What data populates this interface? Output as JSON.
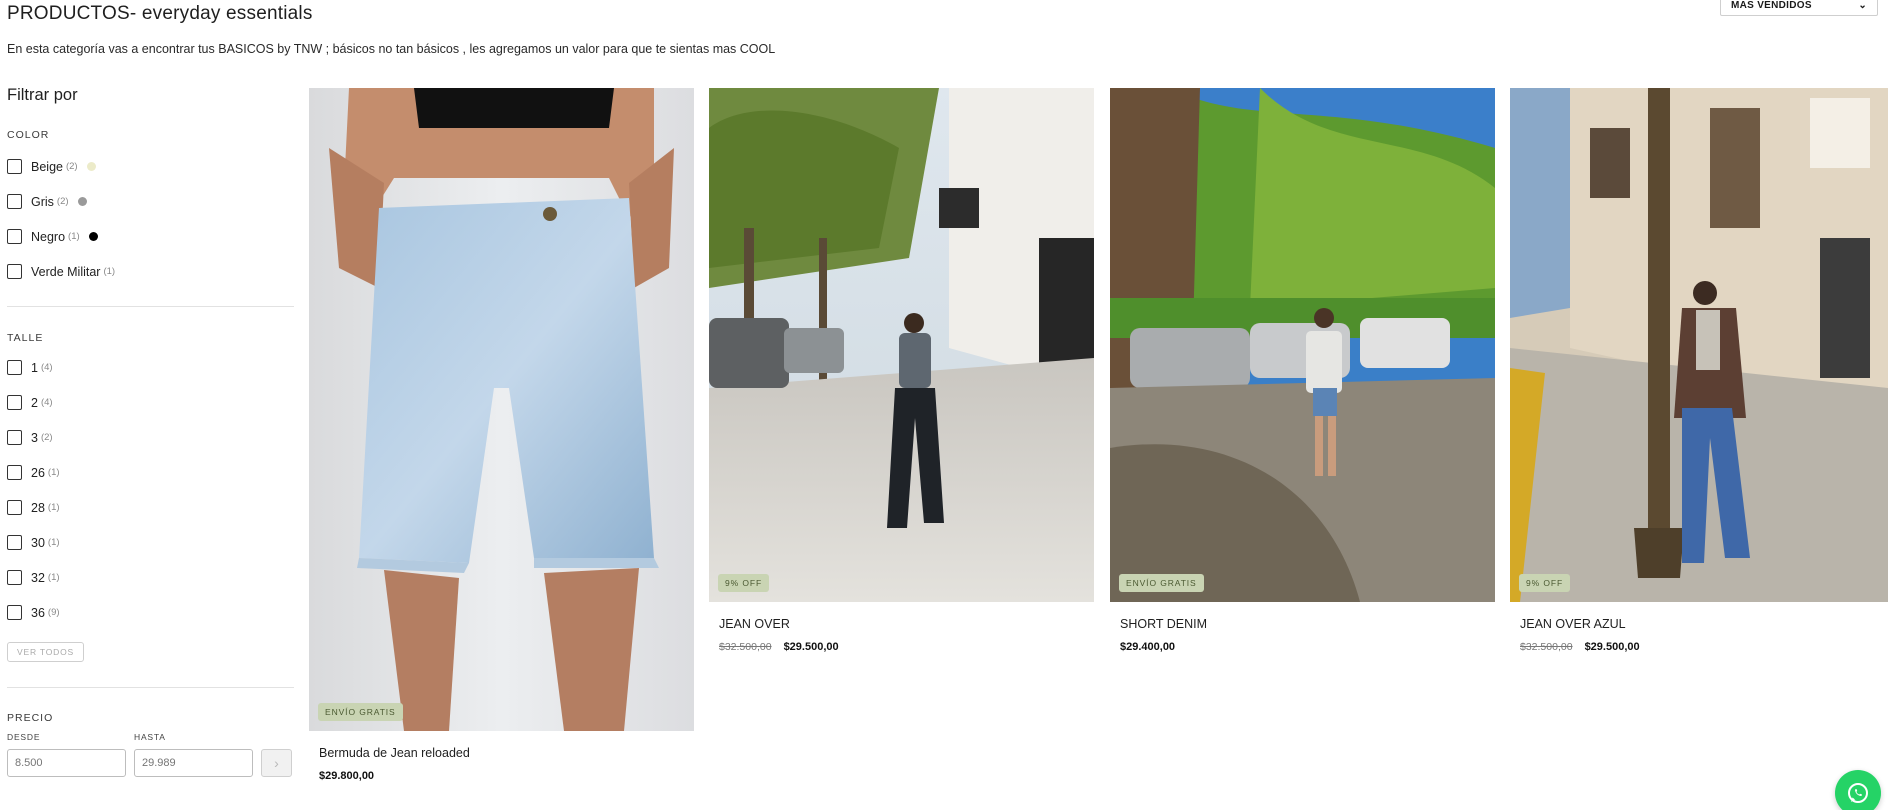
{
  "header": {
    "title": "PRODUCTOS- everyday essentials",
    "description": "En esta categoría vas a encontrar tus BASICOS by TNW ; básicos no tan básicos , les agregamos un valor para que te sientas mas COOL",
    "sort_label": "MAS VENDIDOS"
  },
  "filters": {
    "title": "Filtrar por",
    "color_label": "COLOR",
    "colors": [
      {
        "label": "Beige",
        "count": "(2)",
        "swatch": "#ecebc9"
      },
      {
        "label": "Gris",
        "count": "(2)",
        "swatch": "#9a9a9a"
      },
      {
        "label": "Negro",
        "count": "(1)",
        "swatch": "#000000"
      },
      {
        "label": "Verde Militar",
        "count": "(1)",
        "swatch": ""
      }
    ],
    "size_label": "TALLE",
    "sizes": [
      {
        "label": "1",
        "count": "(4)"
      },
      {
        "label": "2",
        "count": "(4)"
      },
      {
        "label": "3",
        "count": "(2)"
      },
      {
        "label": "26",
        "count": "(1)"
      },
      {
        "label": "28",
        "count": "(1)"
      },
      {
        "label": "30",
        "count": "(1)"
      },
      {
        "label": "32",
        "count": "(1)"
      },
      {
        "label": "36",
        "count": "(9)"
      }
    ],
    "see_all": "VER TODOS",
    "price_label": "PRECIO",
    "from_label": "DESDE",
    "to_label": "HASTA",
    "from_placeholder": "8.500",
    "to_placeholder": "29.989"
  },
  "products": [
    {
      "name": "Bermuda de Jean reloaded",
      "price": "$29.800,00",
      "old_price": "",
      "badge": "ENVÍO GRATIS"
    },
    {
      "name": "JEAN OVER",
      "price": "$29.500,00",
      "old_price": "$32.500,00",
      "badge": "9% OFF"
    },
    {
      "name": "SHORT DENIM",
      "price": "$29.400,00",
      "old_price": "",
      "badge": "ENVÍO GRATIS"
    },
    {
      "name": "JEAN OVER AZUL",
      "price": "$29.500,00",
      "old_price": "$32.500,00",
      "badge": "9% OFF"
    }
  ],
  "colors": {
    "badge_bg": "#c9d4b3",
    "whatsapp": "#25d366"
  }
}
